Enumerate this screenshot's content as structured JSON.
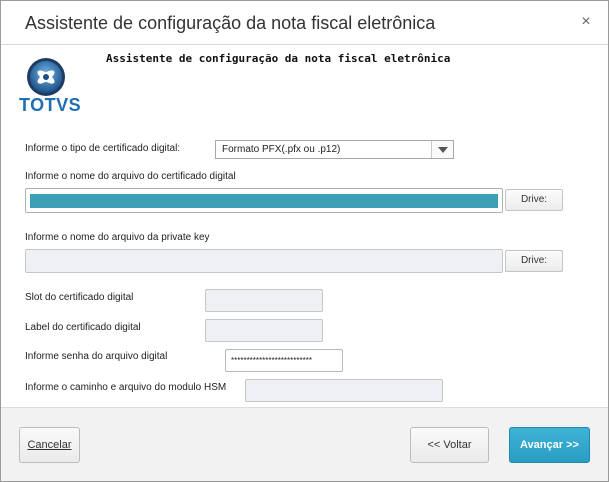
{
  "window": {
    "title": "Assistente de configuração da nota fiscal eletrônica",
    "close_glyph": "×"
  },
  "header": {
    "logo_text": "TOTVS",
    "title": "Assistente de configuração da nota fiscal eletrônica"
  },
  "form": {
    "cert_type_label": "Informe o tipo de certificado digital:",
    "cert_type_value": "Formato PFX(.pfx ou .p12)",
    "cert_file_label": "Informe o nome do arquivo do certificado digital",
    "cert_file_drive_label": "Drive:",
    "private_key_label": "Informe o nome do arquivo da private key",
    "private_key_drive_label": "Drive:",
    "slot_label": "Slot do certificado digital",
    "cert_label_label": "Label do certificado digital",
    "password_label": "Informe senha do arquivo digital",
    "password_value": "**************************",
    "hsm_label": "Informe o caminho e arquivo do modulo HSM"
  },
  "footer": {
    "cancel_label": "Cancelar",
    "back_label": "<< Voltar",
    "next_label": "Avançar >>"
  },
  "colors": {
    "accent": "#2a9dc3",
    "selection": "#3d9fb6",
    "brand": "#1f6fb2"
  },
  "icons": {
    "logo": "totvs-logo-icon",
    "close": "close-icon",
    "dropdown": "chevron-down-icon"
  }
}
